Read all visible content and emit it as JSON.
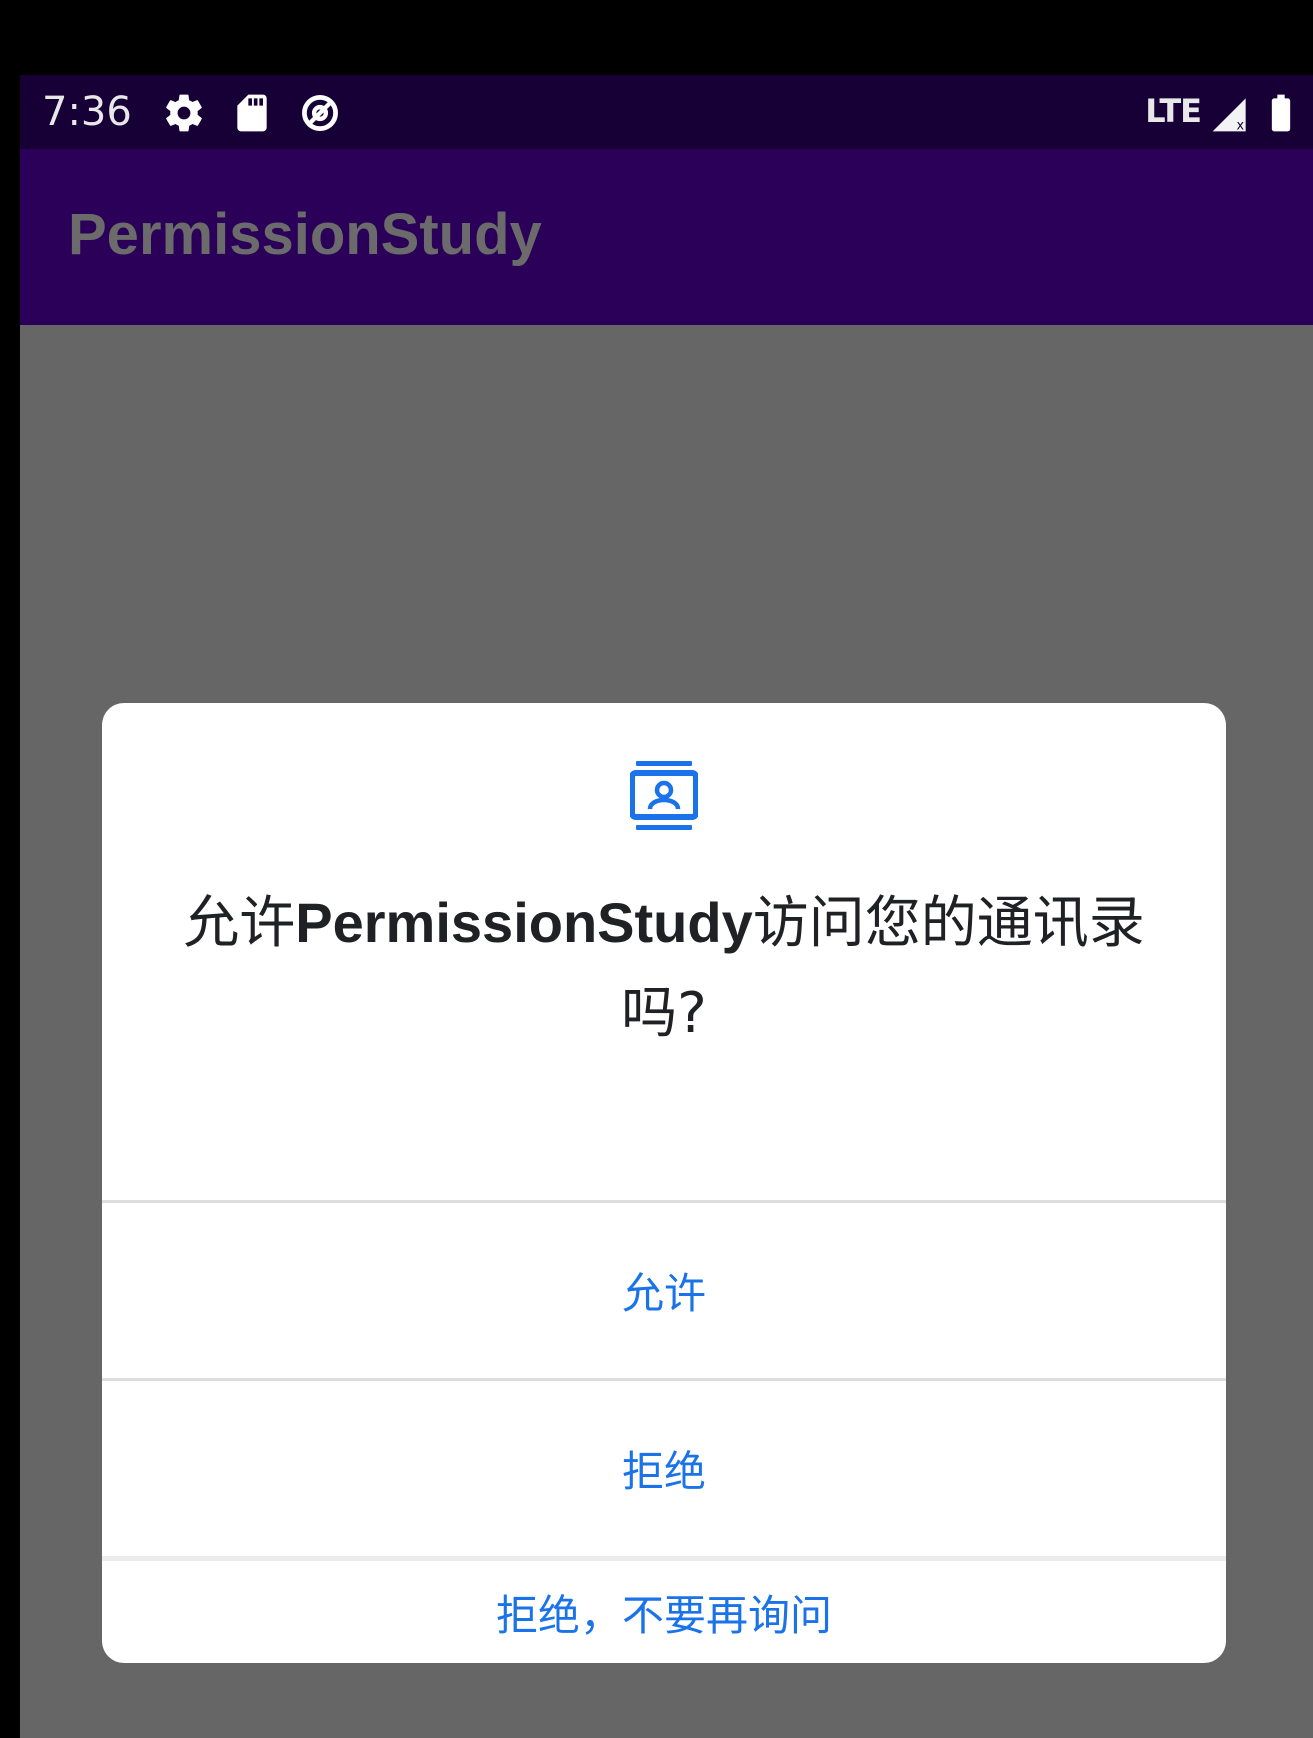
{
  "status_bar": {
    "time": "7:36",
    "icons": [
      "settings-gear-icon",
      "sd-card-icon",
      "data-saver-icon"
    ],
    "network": "LTE",
    "signal_icon": "cell-signal-icon",
    "battery_icon": "battery-icon"
  },
  "app_bar": {
    "title": "PermissionStudy"
  },
  "dialog": {
    "icon": "contacts-icon",
    "message_prefix": "允许",
    "app_name": "PermissionStudy",
    "message_suffix": "访问您的通讯录吗?",
    "buttons": {
      "allow": "允许",
      "deny": "拒绝",
      "deny_dont_ask": "拒绝，不要再询问"
    },
    "accent_color": "#1a73e8"
  },
  "colors": {
    "status_bar": "#160036",
    "app_bar": "#2a0059",
    "scrim": "#666666",
    "dialog_bg": "#ffffff"
  }
}
